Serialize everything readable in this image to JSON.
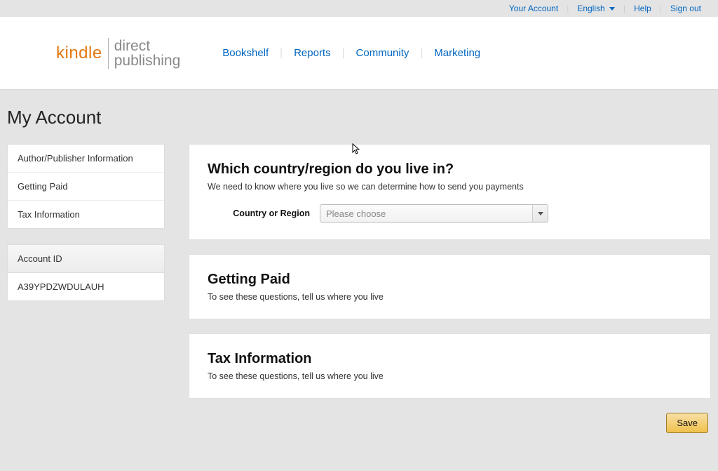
{
  "topbar": {
    "account": "Your Account",
    "language": "English",
    "help": "Help",
    "signout": "Sign out"
  },
  "logo": {
    "kindle": "kindle",
    "direct": "direct",
    "publishing": "publishing"
  },
  "nav": {
    "bookshelf": "Bookshelf",
    "reports": "Reports",
    "community": "Community",
    "marketing": "Marketing"
  },
  "page_title": "My Account",
  "sidebar": {
    "items": [
      "Author/Publisher Information",
      "Getting Paid",
      "Tax Information"
    ],
    "account_id_label": "Account ID",
    "account_id_value": "A39YPDZWDULAUH"
  },
  "cards": {
    "country": {
      "title": "Which country/region do you live in?",
      "subtitle": "We need to know where you live so we can determine how to send you payments",
      "field_label": "Country or Region",
      "placeholder": "Please choose"
    },
    "getting_paid": {
      "title": "Getting Paid",
      "subtitle": "To see these questions, tell us where you live"
    },
    "tax": {
      "title": "Tax Information",
      "subtitle": "To see these questions, tell us where you live"
    }
  },
  "buttons": {
    "save": "Save"
  }
}
